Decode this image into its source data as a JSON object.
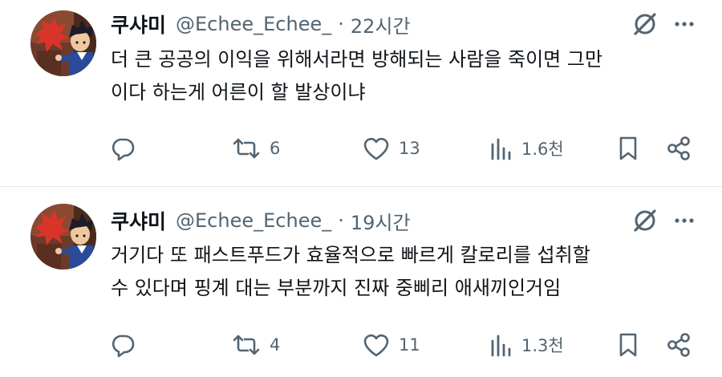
{
  "tweets": [
    {
      "author_name": "쿠샤미",
      "handle": "@Echee_Echee_",
      "separator": "·",
      "time": "22시간",
      "text_lines": [
        "더 큰 공공의 이익을 위해서라면 방해되는 사람을 죽이면 그만",
        "이다 하는게 어른이 할 발상이냐"
      ],
      "retweets": "6",
      "likes": "13",
      "views": "1.6천"
    },
    {
      "author_name": "쿠샤미",
      "handle": "@Echee_Echee_",
      "separator": "·",
      "time": "19시간",
      "text_lines": [
        "거기다 또 패스트푸드가 효율적으로 빠르게 칼로리를 섭취할",
        "수 있다며 핑계 대는 부분까지 진짜 중삐리 애새끼인거임"
      ],
      "retweets": "4",
      "likes": "11",
      "views": "1.3천"
    }
  ],
  "icons": {
    "reply": "reply-icon",
    "retweet": "retweet-icon",
    "like": "like-icon",
    "views": "views-icon",
    "bookmark": "bookmark-icon",
    "share": "share-icon",
    "grok": "grok-icon",
    "more": "more-icon"
  },
  "colors": {
    "text": "#0f1419",
    "secondary": "#536471",
    "divider": "#e7e9ea",
    "background": "#ffffff"
  }
}
